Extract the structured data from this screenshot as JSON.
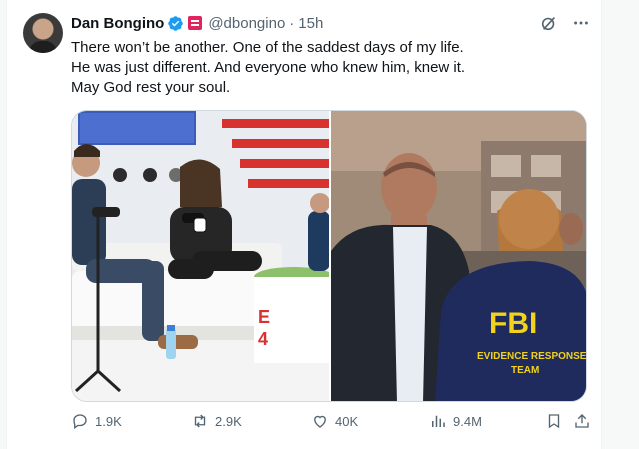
{
  "tweet": {
    "author_name": "Dan Bongino",
    "handle": "@dbongino",
    "separator": "·",
    "time": "15h",
    "text_lines": [
      "There won’t be another. One of the saddest days of my life.",
      "He was just different. And everyone who knew him, knew it.",
      "May God rest your soul."
    ],
    "media": {
      "left_photo_alt": "Podcast stage with hosts seated on white couch",
      "right_photo_alt": "Man in dark jacket beside FBI agent",
      "fbi_text": "FBI",
      "vest_line1": "EVIDENCE RESPONSE",
      "vest_line2": "TEAM"
    }
  },
  "metrics": {
    "replies": "1.9K",
    "reposts": "2.9K",
    "likes": "40K",
    "views": "9.4M"
  },
  "colors": {
    "verified": "#1d9bf0",
    "affiliation_badge": "#e0245e",
    "secondary_text": "#536471"
  },
  "icons": {
    "verified": "verified-badge-icon",
    "affiliation": "affiliation-badge-icon",
    "grok": "grok-icon",
    "more": "more-icon",
    "reply": "reply-icon",
    "repost": "repost-icon",
    "like": "like-icon",
    "views": "views-icon",
    "bookmark": "bookmark-icon",
    "share": "share-icon"
  }
}
